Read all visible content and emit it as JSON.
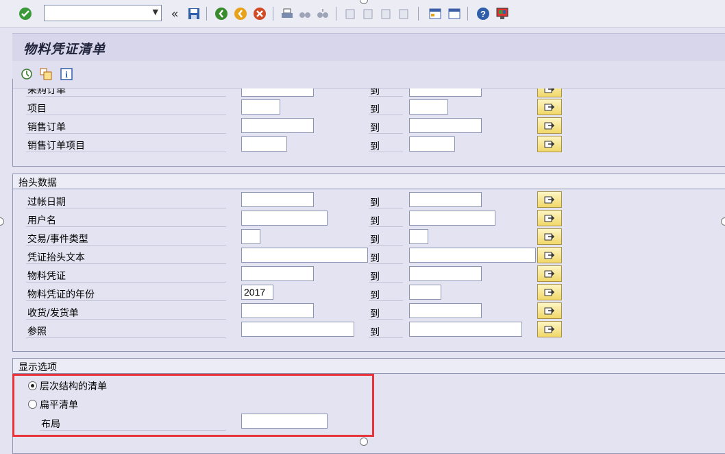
{
  "toolbar": {
    "command_value": "",
    "icons": [
      "check-icon",
      "back-nav-icon",
      "save-icon",
      "back-icon",
      "exit-icon",
      "cancel-icon",
      "print-icon",
      "find-icon",
      "find-next-icon",
      "first-page-icon",
      "prev-page-icon",
      "next-page-icon",
      "last-page-icon",
      "new-session-icon",
      "shortcut-icon",
      "help-icon",
      "customize-layout-icon"
    ]
  },
  "title": "物料凭证清单",
  "app_toolbar": {
    "icons": [
      "execute-icon",
      "get-variant-icon",
      "info-icon"
    ]
  },
  "to_label": "到",
  "section1": {
    "rows": [
      {
        "label": "采购订单",
        "from": "",
        "to": ""
      },
      {
        "label": "项目",
        "from": "",
        "to": ""
      },
      {
        "label": "销售订单",
        "from": "",
        "to": ""
      },
      {
        "label": "销售订单项目",
        "from": "",
        "to": ""
      }
    ]
  },
  "header_data": {
    "title": "抬头数据",
    "rows": [
      {
        "label": "过帐日期",
        "from": "",
        "to": ""
      },
      {
        "label": "用户名",
        "from": "",
        "to": ""
      },
      {
        "label": "交易/事件类型",
        "from": "",
        "to": ""
      },
      {
        "label": "凭证抬头文本",
        "from": "",
        "to": ""
      },
      {
        "label": "物料凭证",
        "from": "",
        "to": ""
      },
      {
        "label": "物料凭证的年份",
        "from": "2017",
        "to": ""
      },
      {
        "label": "收货/发货单",
        "from": "",
        "to": ""
      },
      {
        "label": "参照",
        "from": "",
        "to": ""
      }
    ]
  },
  "display_options": {
    "title": "显示选项",
    "hierarchical_label": "层次结构的清单",
    "hierarchical_selected": true,
    "flat_label": "扁平清单",
    "flat_selected": false,
    "layout_label": "布局",
    "layout_value": ""
  },
  "colors": {
    "background": "#e3e3f2",
    "highlight_border": "#e8333a",
    "multi_select_button": "#f1d869"
  }
}
